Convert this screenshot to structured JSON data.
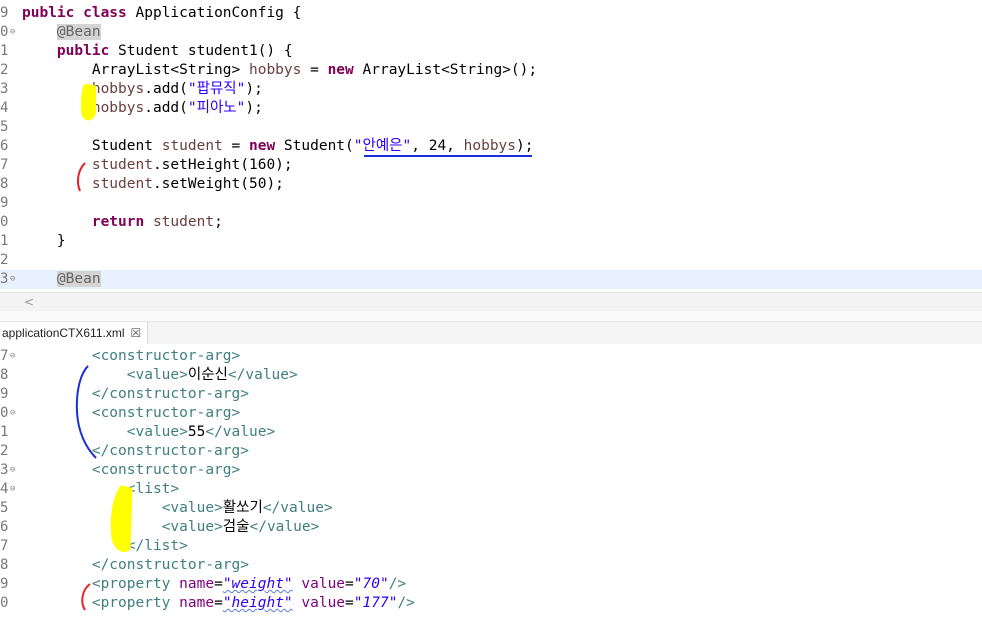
{
  "java_editor": {
    "lines": [
      {
        "ln": "9",
        "fold": false,
        "hl": false,
        "parts": [
          [
            "kw",
            "public class "
          ],
          [
            "",
            "ApplicationConfig {"
          ]
        ]
      },
      {
        "ln": "0",
        "fold": true,
        "hl": false,
        "parts": [
          [
            "",
            "    "
          ],
          [
            "ann",
            "@Bean"
          ]
        ]
      },
      {
        "ln": "1",
        "fold": false,
        "hl": false,
        "parts": [
          [
            "",
            "    "
          ],
          [
            "kw",
            "public "
          ],
          [
            "",
            "Student student1() {"
          ]
        ]
      },
      {
        "ln": "2",
        "fold": false,
        "hl": false,
        "parts": [
          [
            "",
            "        ArrayList<String> "
          ],
          [
            "var",
            "hobbys"
          ],
          [
            "",
            " = "
          ],
          [
            "kw",
            "new "
          ],
          [
            "",
            "ArrayList<String>();"
          ]
        ]
      },
      {
        "ln": "3",
        "fold": false,
        "hl": false,
        "parts": [
          [
            "",
            "        "
          ],
          [
            "var",
            "hobbys"
          ],
          [
            "",
            ".add("
          ],
          [
            "str",
            "\"팝뮤직\""
          ],
          [
            "",
            ");"
          ]
        ]
      },
      {
        "ln": "4",
        "fold": false,
        "hl": false,
        "parts": [
          [
            "",
            "        "
          ],
          [
            "var",
            "hobbys"
          ],
          [
            "",
            ".add("
          ],
          [
            "str",
            "\"피아노\""
          ],
          [
            "",
            ");"
          ]
        ]
      },
      {
        "ln": "5",
        "fold": false,
        "hl": false,
        "parts": []
      },
      {
        "ln": "6",
        "fold": false,
        "hl": false,
        "parts": [
          [
            "",
            "        Student "
          ],
          [
            "var",
            "student"
          ],
          [
            "",
            " = "
          ],
          [
            "kw",
            "new "
          ],
          [
            "",
            "Student("
          ],
          [
            "str",
            "\"안예은\""
          ],
          [
            "",
            ", 24, "
          ],
          [
            "var",
            "hobbys"
          ],
          [
            "",
            ");"
          ]
        ]
      },
      {
        "ln": "7",
        "fold": false,
        "hl": false,
        "parts": [
          [
            "",
            "        "
          ],
          [
            "var",
            "student"
          ],
          [
            "",
            ".setHeight(160);"
          ]
        ]
      },
      {
        "ln": "8",
        "fold": false,
        "hl": false,
        "parts": [
          [
            "",
            "        "
          ],
          [
            "var",
            "student"
          ],
          [
            "",
            ".setWeight(50);"
          ]
        ]
      },
      {
        "ln": "9",
        "fold": false,
        "hl": false,
        "parts": []
      },
      {
        "ln": "0",
        "fold": false,
        "hl": false,
        "parts": [
          [
            "",
            "        "
          ],
          [
            "kw",
            "return "
          ],
          [
            "var",
            "student"
          ],
          [
            "",
            ";"
          ]
        ]
      },
      {
        "ln": "1",
        "fold": false,
        "hl": false,
        "parts": [
          [
            "",
            "    }"
          ]
        ]
      },
      {
        "ln": "2",
        "fold": false,
        "hl": false,
        "parts": []
      },
      {
        "ln": "3",
        "fold": true,
        "hl": true,
        "parts": [
          [
            "",
            "    "
          ],
          [
            "ann",
            "@Bean"
          ]
        ]
      }
    ]
  },
  "xml_tab": {
    "label": "applicationCTX611.xml",
    "close_glyph": "☒"
  },
  "xml_editor": {
    "lines": [
      {
        "ln": "7",
        "fold": true,
        "parts": [
          [
            "",
            "        "
          ],
          [
            "xtag",
            "<constructor-arg>"
          ]
        ]
      },
      {
        "ln": "8",
        "fold": false,
        "parts": [
          [
            "",
            "            "
          ],
          [
            "xtag",
            "<value>"
          ],
          [
            "",
            "이순신"
          ],
          [
            "xtag",
            "</value>"
          ]
        ]
      },
      {
        "ln": "9",
        "fold": false,
        "parts": [
          [
            "",
            "        "
          ],
          [
            "xtag",
            "</constructor-arg>"
          ]
        ]
      },
      {
        "ln": "0",
        "fold": true,
        "parts": [
          [
            "",
            "        "
          ],
          [
            "xtag",
            "<constructor-arg>"
          ]
        ]
      },
      {
        "ln": "1",
        "fold": false,
        "parts": [
          [
            "",
            "            "
          ],
          [
            "xtag",
            "<value>"
          ],
          [
            "",
            "55"
          ],
          [
            "xtag",
            "</value>"
          ]
        ]
      },
      {
        "ln": "2",
        "fold": false,
        "parts": [
          [
            "",
            "        "
          ],
          [
            "xtag",
            "</constructor-arg>"
          ]
        ]
      },
      {
        "ln": "3",
        "fold": true,
        "parts": [
          [
            "",
            "        "
          ],
          [
            "xtag",
            "<constructor-arg>"
          ]
        ]
      },
      {
        "ln": "4",
        "fold": true,
        "parts": [
          [
            "",
            "            "
          ],
          [
            "xtag",
            "<list>"
          ]
        ]
      },
      {
        "ln": "5",
        "fold": false,
        "parts": [
          [
            "",
            "                "
          ],
          [
            "xtag",
            "<value>"
          ],
          [
            "",
            "활쏘기"
          ],
          [
            "xtag",
            "</value>"
          ]
        ]
      },
      {
        "ln": "6",
        "fold": false,
        "parts": [
          [
            "",
            "                "
          ],
          [
            "xtag",
            "<value>"
          ],
          [
            "",
            "검술"
          ],
          [
            "xtag",
            "</value>"
          ]
        ]
      },
      {
        "ln": "7",
        "fold": false,
        "parts": [
          [
            "",
            "            "
          ],
          [
            "xtag",
            "</list>"
          ]
        ]
      },
      {
        "ln": "8",
        "fold": false,
        "parts": [
          [
            "",
            "        "
          ],
          [
            "xtag",
            "</constructor-arg>"
          ]
        ]
      },
      {
        "ln": "9",
        "fold": false,
        "parts": [
          [
            "",
            "        "
          ],
          [
            "xtag",
            "<property "
          ],
          [
            "xattr",
            "name"
          ],
          [
            "",
            "="
          ],
          [
            "xval",
            "\"weight\""
          ],
          [
            "",
            " "
          ],
          [
            "xattr",
            "value"
          ],
          [
            "",
            "="
          ],
          [
            "xval",
            "\"70\""
          ],
          [
            "xtag",
            "/>"
          ]
        ]
      },
      {
        "ln": "0",
        "fold": false,
        "parts": [
          [
            "",
            "        "
          ],
          [
            "xtag",
            "<property "
          ],
          [
            "xattr",
            "name"
          ],
          [
            "",
            "="
          ],
          [
            "xval",
            "\"height\""
          ],
          [
            "",
            " "
          ],
          [
            "xattr",
            "value"
          ],
          [
            "",
            "="
          ],
          [
            "xval",
            "\"177\""
          ],
          [
            "xtag",
            "/>"
          ]
        ]
      }
    ]
  },
  "colors": {
    "yellow_marker": "#ffff00",
    "red_marker": "#e8202a",
    "blue_marker": "#1a2fd6"
  }
}
